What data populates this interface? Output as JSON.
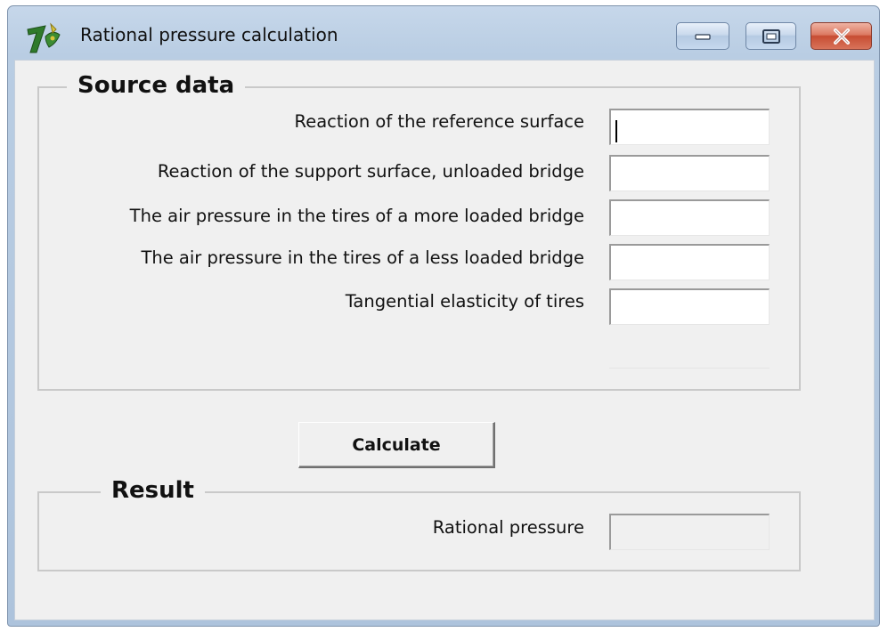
{
  "window": {
    "title": "Rational pressure calculation",
    "icon": "app-logo-icon",
    "controls": [
      "minimize-icon",
      "maximize-icon",
      "close-icon"
    ]
  },
  "source": {
    "heading": "Source data",
    "fields": [
      {
        "label": "Reaction of the reference surface",
        "value": ""
      },
      {
        "label": "Reaction of the support surface, unloaded bridge",
        "value": ""
      },
      {
        "label": "The air pressure in the tires of a more loaded bridge",
        "value": ""
      },
      {
        "label": "The air pressure in the tires of a less loaded bridge",
        "value": ""
      },
      {
        "label": "Tangential elasticity of tires",
        "value": ""
      }
    ]
  },
  "actions": {
    "calculate_label": "Calculate"
  },
  "result": {
    "heading": "Result",
    "label": "Rational pressure",
    "value": ""
  },
  "colors": {
    "window_frame": "#b9cde3",
    "client_background": "#f0f0f0",
    "close_button": "#c74d33"
  }
}
